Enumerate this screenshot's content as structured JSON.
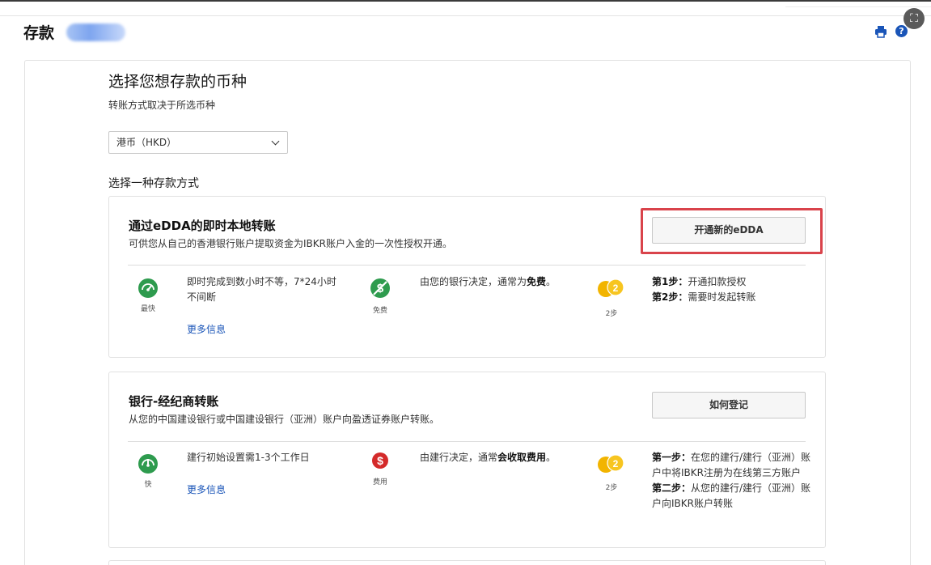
{
  "page": {
    "title": "存款"
  },
  "header_icons": {
    "help_glyph": "?"
  },
  "currency_section": {
    "heading": "选择您想存款的币种",
    "subtext": "转账方式取决于所选币种",
    "selected_currency": "港币（HKD）",
    "method_label": "选择一种存款方式"
  },
  "methods": [
    {
      "title": "通过eDDA的即时本地转账",
      "description": "可供您从自己的香港银行账户提取资金为IBKR账户入金的一次性授权开通。",
      "button_label": "开通新的eDDA",
      "speed": {
        "caption": "最快",
        "text": "即时完成到数小时不等，7*24小时不间断",
        "more_link": "更多信息"
      },
      "fee": {
        "caption": "免费",
        "text_prefix": "由您的银行决定，通常为",
        "text_bold": "免费",
        "text_suffix": "。"
      },
      "steps": {
        "caption": "2步",
        "step1_label": "第1步：",
        "step1_text": "开通扣款授权",
        "step2_label": "第2步：",
        "step2_text": "需要时发起转账"
      }
    },
    {
      "title": "银行-经纪商转账",
      "description": "从您的中国建设银行或中国建设银行（亚洲）账户向盈透证券账户转账。",
      "button_label": "如何登记",
      "speed": {
        "caption": "快",
        "text": "建行初始设置需1-3个工作日",
        "more_link": "更多信息"
      },
      "fee": {
        "caption": "费用",
        "text_prefix": "由建行决定，通常",
        "text_bold": "会收取费用",
        "text_suffix": "。"
      },
      "steps": {
        "caption": "2步",
        "step1_label": "第一步：",
        "step1_text": "在您的建行/建行（亚洲）账户中将IBKR注册为在线第三方账户",
        "step2_label": "第二步：",
        "step2_text": "从您的建行/建行（亚洲）账户向IBKR账户转账"
      }
    }
  ],
  "colors": {
    "accent_blue": "#1a55b8",
    "fast_green": "#2e9b4e",
    "fee_red": "#d42a2a",
    "coin_gold": "#f2b400",
    "highlight_red": "#d9434b"
  },
  "icons": {
    "print": "printer-icon",
    "help": "help-icon",
    "speed": "speedometer-icon",
    "free": "no-fee-icon",
    "fee": "dollar-icon",
    "steps": "coins-icon",
    "select": "chevron-down-icon"
  }
}
